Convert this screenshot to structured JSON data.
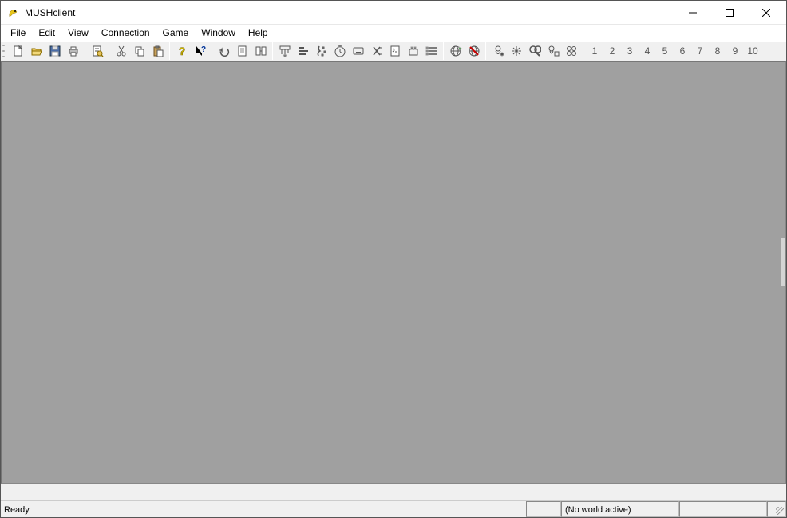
{
  "window": {
    "title": "MUSHclient"
  },
  "menu": {
    "items": [
      "File",
      "Edit",
      "View",
      "Connection",
      "Game",
      "Window",
      "Help"
    ]
  },
  "toolbar": {
    "groups": [
      {
        "buttons": [
          {
            "icon": "new-file-icon",
            "name": "new-button"
          },
          {
            "icon": "open-icon",
            "name": "open-button"
          },
          {
            "icon": "save-icon",
            "name": "save-button",
            "disabled": true
          },
          {
            "icon": "print-icon",
            "name": "print-button",
            "disabled": true
          }
        ]
      },
      {
        "buttons": [
          {
            "icon": "preferences-icon",
            "name": "preferences-button"
          }
        ]
      },
      {
        "buttons": [
          {
            "icon": "cut-icon",
            "name": "cut-button",
            "disabled": true
          },
          {
            "icon": "copy-icon",
            "name": "copy-button",
            "disabled": true
          },
          {
            "icon": "paste-icon",
            "name": "paste-button",
            "disabled": true
          }
        ]
      },
      {
        "buttons": [
          {
            "icon": "help-icon",
            "name": "help-button"
          },
          {
            "icon": "context-help-icon",
            "name": "context-help-button"
          }
        ]
      },
      {
        "buttons": [
          {
            "icon": "undo-icon",
            "name": "undo-button",
            "disabled": true
          },
          {
            "icon": "notepad-icon",
            "name": "notepad-button",
            "disabled": true
          },
          {
            "icon": "recall-icon",
            "name": "recall-button",
            "disabled": true
          }
        ]
      },
      {
        "buttons": [
          {
            "icon": "triggers-icon",
            "name": "triggers-button",
            "disabled": true
          },
          {
            "icon": "aliases-icon",
            "name": "aliases-button",
            "disabled": true
          },
          {
            "icon": "keypad-icon",
            "name": "keypad-button",
            "disabled": true
          },
          {
            "icon": "timers-icon",
            "name": "timers-button",
            "disabled": true
          },
          {
            "icon": "macros-icon",
            "name": "macros-button",
            "disabled": true
          },
          {
            "icon": "variables-icon",
            "name": "variables-button",
            "disabled": true
          },
          {
            "icon": "scripts-icon",
            "name": "scripts-button",
            "disabled": true
          },
          {
            "icon": "plugins-icon",
            "name": "plugins-button",
            "disabled": true
          },
          {
            "icon": "world-config-icon",
            "name": "world-config-button",
            "disabled": true
          }
        ]
      },
      {
        "buttons": [
          {
            "icon": "connect-icon",
            "name": "connect-button",
            "disabled": true
          },
          {
            "icon": "disconnect-icon",
            "name": "disconnect-button",
            "disabled": true
          }
        ]
      },
      {
        "buttons": [
          {
            "icon": "debug1-icon",
            "name": "debug1-button",
            "disabled": true
          },
          {
            "icon": "debug2-icon",
            "name": "debug2-button",
            "disabled": true
          },
          {
            "icon": "find-icon",
            "name": "find-button",
            "disabled": true
          },
          {
            "icon": "debug3-icon",
            "name": "debug3-button",
            "disabled": true
          },
          {
            "icon": "debug4-icon",
            "name": "debug4-button",
            "disabled": true
          }
        ]
      },
      {
        "buttons": [
          {
            "text": "1",
            "name": "world-1-button"
          },
          {
            "text": "2",
            "name": "world-2-button"
          },
          {
            "text": "3",
            "name": "world-3-button"
          },
          {
            "text": "4",
            "name": "world-4-button"
          },
          {
            "text": "5",
            "name": "world-5-button"
          },
          {
            "text": "6",
            "name": "world-6-button"
          },
          {
            "text": "7",
            "name": "world-7-button"
          },
          {
            "text": "8",
            "name": "world-8-button"
          },
          {
            "text": "9",
            "name": "world-9-button"
          },
          {
            "text": "10",
            "name": "world-10-button"
          }
        ]
      }
    ]
  },
  "status": {
    "ready": "Ready",
    "world": "(No world active)"
  }
}
